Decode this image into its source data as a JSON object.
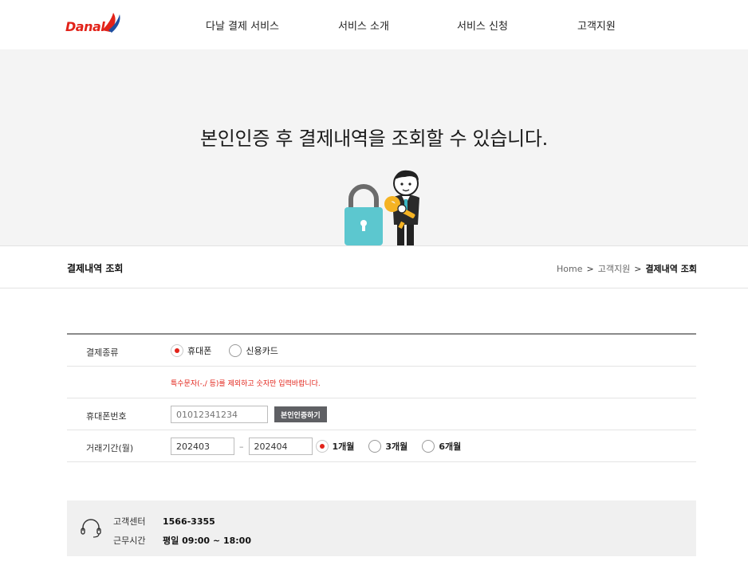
{
  "header": {
    "logo_text": "Danal",
    "nav": [
      "다날 결제 서비스",
      "서비스 소개",
      "서비스 신청",
      "고객지원"
    ]
  },
  "hero": {
    "title": "본인인증 후 결제내역을 조회할 수 있습니다."
  },
  "subbar": {
    "page_title": "결제내역 조회",
    "breadcrumb": [
      "Home",
      "고객지원",
      "결제내역 조회"
    ],
    "separator": ">"
  },
  "form": {
    "payment_type": {
      "label": "결제종류",
      "options": [
        "휴대폰",
        "신용카드"
      ],
      "selected": "휴대폰"
    },
    "notice": "특수문자(-,/ 등)를 제외하고 숫자만 입력바랍니다.",
    "phone": {
      "label": "휴대폰번호",
      "placeholder": "01012341234",
      "verify_button": "본인인증하기"
    },
    "period": {
      "label": "거래기간(월)",
      "from": "202403",
      "to": "202404",
      "dash": "–",
      "options": [
        "1개월",
        "3개월",
        "6개월"
      ],
      "selected": "1개월"
    }
  },
  "customer_center": {
    "center_label": "고객센터",
    "center_value": "1566-3355",
    "hours_label": "근무시간",
    "hours_value": "평일 09:00 ~ 18:00"
  },
  "colors": {
    "brand_red": "#e2231a",
    "hero_bg": "#f4f4f4",
    "lock_teal": "#5cc7cf",
    "key_yellow": "#f5b323"
  }
}
